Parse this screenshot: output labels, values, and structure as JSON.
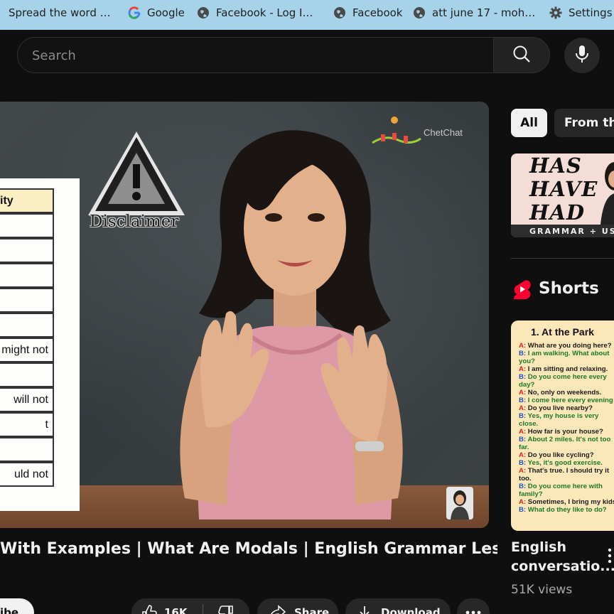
{
  "bookmarks": [
    {
      "label": "Spread the word ab...",
      "icon": "globe-icon"
    },
    {
      "label": "Google",
      "icon": "google-icon"
    },
    {
      "label": "Facebook - Log In o...",
      "icon": "globe-icon"
    },
    {
      "label": "Facebook",
      "icon": "globe-icon"
    },
    {
      "label": "att june 17 - mohan...",
      "icon": "globe-icon"
    },
    {
      "label": "Settings",
      "icon": "gear-icon"
    }
  ],
  "header": {
    "search_placeholder": "Search"
  },
  "player": {
    "modal_table": [
      "ity",
      "",
      "",
      "",
      "",
      "might not",
      "",
      "will not",
      "t",
      "",
      "uld not"
    ],
    "disclaimer_text": "Disclaimer",
    "channel_logo_text": "ChetChat"
  },
  "video": {
    "title": "With Examples | What Are Modals | English Grammar Lesson |",
    "subscribe_label": "ribe",
    "like_count": "16K",
    "share_label": "Share",
    "download_label": "Download"
  },
  "sidebar": {
    "chips": [
      "All",
      "From the"
    ],
    "recommended_thumb": {
      "lines": [
        "HAS",
        "HAVE",
        "HAD"
      ],
      "strip_text": "GRAMMAR + USAGE"
    },
    "shorts_title": "Shorts",
    "short": {
      "heading": "1. At the Park",
      "dialogue": [
        {
          "speaker": "A:",
          "text": "What are you doing here?"
        },
        {
          "speaker": "B:",
          "text": "I am walking. What about"
        },
        {
          "speaker": "",
          "text": "you?"
        },
        {
          "speaker": "A:",
          "text": "I am sitting and relaxing."
        },
        {
          "speaker": "B:",
          "text": "Do you come here every"
        },
        {
          "speaker": "",
          "text": "day?"
        },
        {
          "speaker": "A:",
          "text": "No, only on weekends."
        },
        {
          "speaker": "B:",
          "text": "I come here every evening"
        },
        {
          "speaker": "A:",
          "text": "Do you live nearby?"
        },
        {
          "speaker": "B:",
          "text": "Yes, my house is very"
        },
        {
          "speaker": "",
          "text": "close."
        },
        {
          "speaker": "A:",
          "text": "How far is your house?"
        },
        {
          "speaker": "B:",
          "text": "About 2 miles. It's not too"
        },
        {
          "speaker": "",
          "text": "far."
        },
        {
          "speaker": "A:",
          "text": "Do you like cycling?"
        },
        {
          "speaker": "B:",
          "text": "Yes, it's good exercise."
        },
        {
          "speaker": "A:",
          "text": "That's true. I should try it"
        },
        {
          "speaker": "",
          "text": "too."
        },
        {
          "speaker": "B:",
          "text": "Do you come here with"
        },
        {
          "speaker": "",
          "text": "family?"
        },
        {
          "speaker": "A:",
          "text": "Sometimes, I bring my kids"
        },
        {
          "speaker": "B:",
          "text": "What do they like to do?"
        }
      ],
      "title": "English conversatio...",
      "views": "51K views"
    }
  },
  "colors": {
    "background": "#0f0f0f",
    "bookmark_bar": "#a7d3ea",
    "shorts_red": "#ff0033",
    "chip_active": "#f1f1f1"
  }
}
